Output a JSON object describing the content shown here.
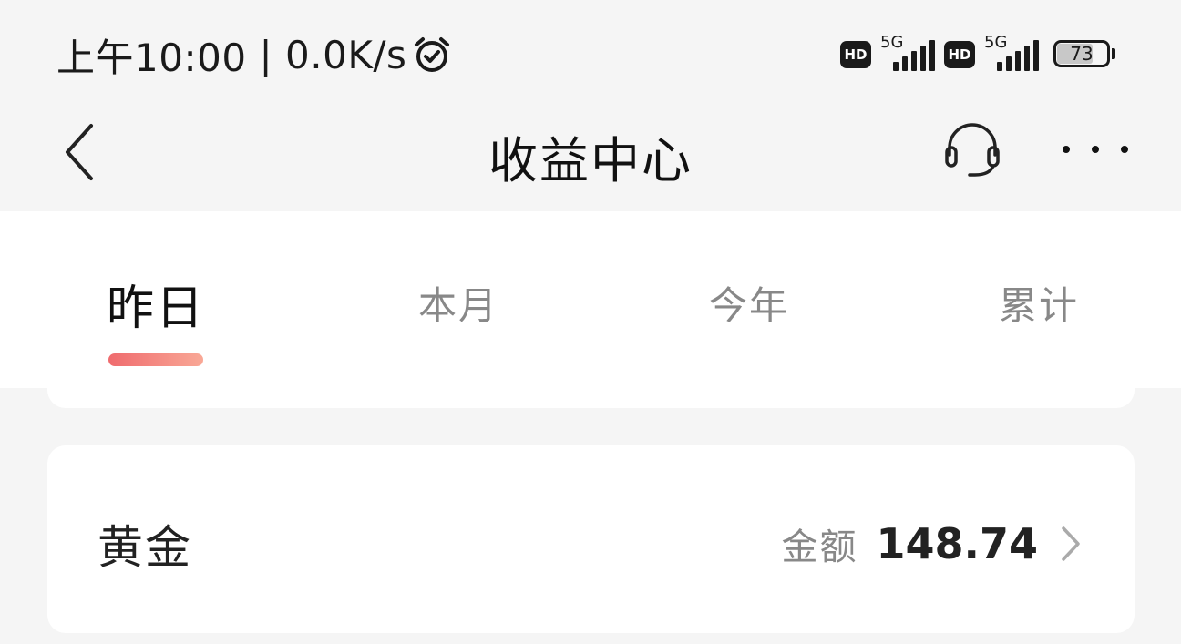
{
  "status_bar": {
    "time": "上午10:00",
    "speed": "| 0.0K/s",
    "sim1": {
      "badge": "HD",
      "network": "5G"
    },
    "sim2": {
      "badge": "HD",
      "network": "5G"
    },
    "battery": "73",
    "battery_level_percent": 73
  },
  "nav": {
    "title": "收益中心",
    "icons": {
      "back": "chevron-left-icon",
      "service": "headset-icon",
      "more": "more-dots-icon"
    }
  },
  "tabs": [
    {
      "label": "昨日",
      "active": true
    },
    {
      "label": "本月",
      "active": false
    },
    {
      "label": "今年",
      "active": false
    },
    {
      "label": "累计",
      "active": false
    }
  ],
  "card": {
    "title": "黄金",
    "amount_label": "金额",
    "amount_value": "148.74"
  },
  "colors": {
    "accent_start": "#ef6b6e",
    "accent_end": "#f9a896",
    "background": "#f5f5f5"
  }
}
